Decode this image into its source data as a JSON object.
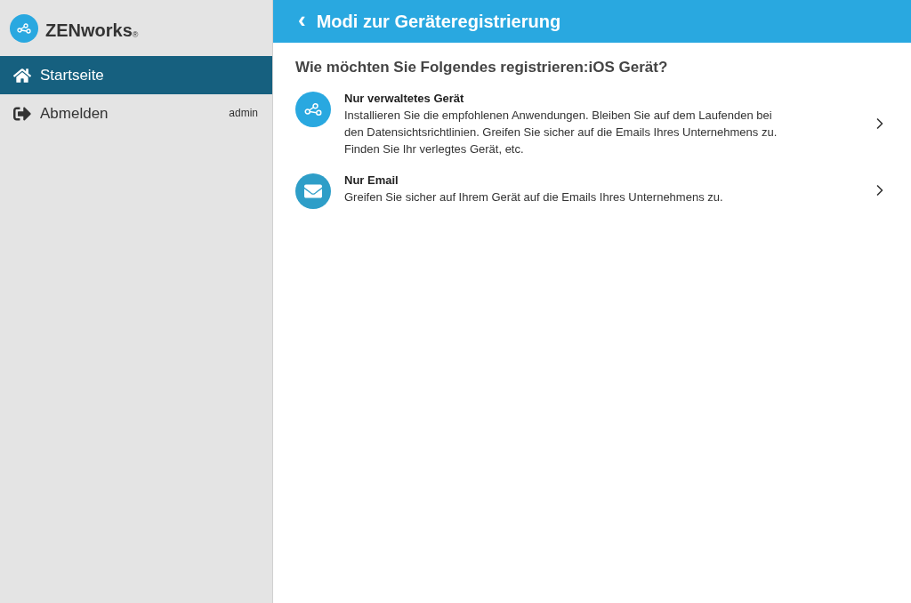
{
  "logo": {
    "name": "ZENworks",
    "mark": "®"
  },
  "nav": [
    {
      "kind": "home",
      "label": "Startseite",
      "selected": true
    },
    {
      "kind": "logout",
      "label": "Abmelden",
      "selected": false,
      "user": "admin"
    }
  ],
  "header": {
    "back": "‹",
    "title": "Modi zur Geräteregistrierung"
  },
  "question": "Wie möchten Sie Folgendes registrieren:iOS Gerät?",
  "options": [
    {
      "kind": "share",
      "title": "Nur verwaltetes Gerät",
      "description": "Installieren Sie die empfohlenen Anwendungen. Bleiben Sie auf dem Laufenden bei den Datensichtsrichtlinien. Greifen Sie sicher auf die Emails Ihres Unternehmens zu. Finden Sie Ihr verlegtes Gerät, etc."
    },
    {
      "kind": "mail",
      "title": "Nur Email",
      "description": "Greifen Sie sicher auf Ihrem Gerät auf die Emails Ihres Unternehmens zu."
    }
  ]
}
